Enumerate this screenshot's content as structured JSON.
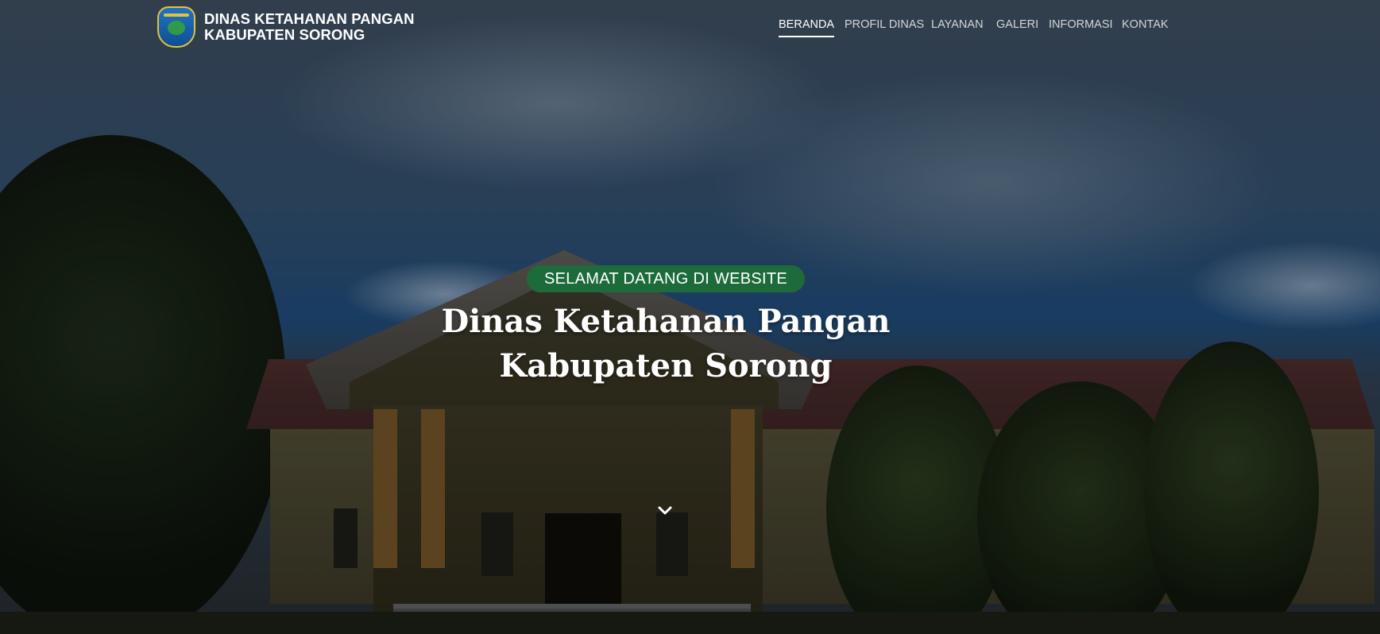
{
  "header": {
    "brand_line1": "DINAS KETAHANAN PANGAN",
    "brand_line2": "KABUPATEN SORONG",
    "logo_icon": "regency-emblem-logo"
  },
  "nav": {
    "items": [
      {
        "label": "BERANDA",
        "active": true
      },
      {
        "label": "PROFIL DINAS",
        "active": false
      },
      {
        "label": "LAYANAN",
        "active": false
      },
      {
        "label": "GALERI",
        "active": false
      },
      {
        "label": "INFORMASI",
        "active": false
      },
      {
        "label": "KONTAK",
        "active": false
      }
    ]
  },
  "hero": {
    "badge": "SELAMAT DATANG DI WEBSITE",
    "title_line1": "Dinas Ketahanan Pangan",
    "title_line2": "Kabupaten Sorong",
    "scroll_icon": "chevron-down-icon"
  },
  "colors": {
    "badge_bg": "#1d6b3b",
    "text": "#ffffff",
    "nav_inactive": "#d3d6da"
  }
}
